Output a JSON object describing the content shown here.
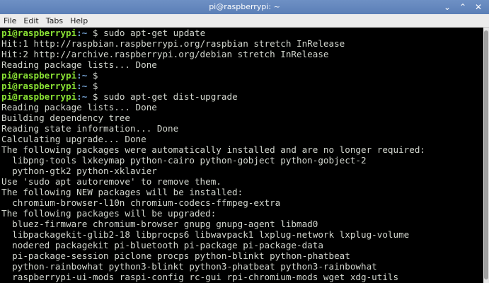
{
  "window": {
    "title": "pi@raspberrypi: ~",
    "minimize_glyph": "⌄",
    "maximize_glyph": "⌃",
    "close_glyph": "✕"
  },
  "menu": [
    "File",
    "Edit",
    "Tabs",
    "Help"
  ],
  "terminal": {
    "prompt_user": "pi@raspberrypi",
    "prompt_sep": ":",
    "prompt_path": "~",
    "prompt_symbol": " $ ",
    "lines": [
      {
        "type": "prompt",
        "cmd": "sudo apt-get update"
      },
      {
        "type": "text",
        "text": "Hit:1 http://raspbian.raspberrypi.org/raspbian stretch InRelease"
      },
      {
        "type": "text",
        "text": "Hit:2 http://archive.raspberrypi.org/debian stretch InRelease"
      },
      {
        "type": "text",
        "text": "Reading package lists... Done"
      },
      {
        "type": "prompt",
        "cmd": ""
      },
      {
        "type": "prompt",
        "cmd": ""
      },
      {
        "type": "prompt",
        "cmd": "sudo apt-get dist-upgrade"
      },
      {
        "type": "text",
        "text": "Reading package lists... Done"
      },
      {
        "type": "text",
        "text": "Building dependency tree"
      },
      {
        "type": "text",
        "text": "Reading state information... Done"
      },
      {
        "type": "text",
        "text": "Calculating upgrade... Done"
      },
      {
        "type": "text",
        "text": "The following packages were automatically installed and are no longer required:"
      },
      {
        "type": "text",
        "text": "  libpng-tools lxkeymap python-cairo python-gobject python-gobject-2"
      },
      {
        "type": "text",
        "text": "  python-gtk2 python-xklavier"
      },
      {
        "type": "text",
        "text": "Use 'sudo apt autoremove' to remove them."
      },
      {
        "type": "text",
        "text": "The following NEW packages will be installed:"
      },
      {
        "type": "text",
        "text": "  chromium-browser-l10n chromium-codecs-ffmpeg-extra"
      },
      {
        "type": "text",
        "text": "The following packages will be upgraded:"
      },
      {
        "type": "text",
        "text": "  bluez-firmware chromium-browser gnupg gnupg-agent libmad0"
      },
      {
        "type": "text",
        "text": "  libpackagekit-glib2-18 libprocps6 libwavpack1 lxplug-network lxplug-volume"
      },
      {
        "type": "text",
        "text": "  nodered packagekit pi-bluetooth pi-package pi-package-data"
      },
      {
        "type": "text",
        "text": "  pi-package-session piclone procps python-blinkt python-phatbeat"
      },
      {
        "type": "text",
        "text": "  python-rainbowhat python3-blinkt python3-phatbeat python3-rainbowhat"
      },
      {
        "type": "text",
        "text": "  raspberrypi-ui-mods raspi-config rc-gui rpi-chromium-mods wget xdg-utils"
      }
    ]
  },
  "colors": {
    "terminal_bg": "#000000",
    "terminal_fg": "#d3d7cf",
    "prompt_user": "#8ae234",
    "prompt_path": "#729fcf",
    "titlebar": "#6b8fc4"
  }
}
